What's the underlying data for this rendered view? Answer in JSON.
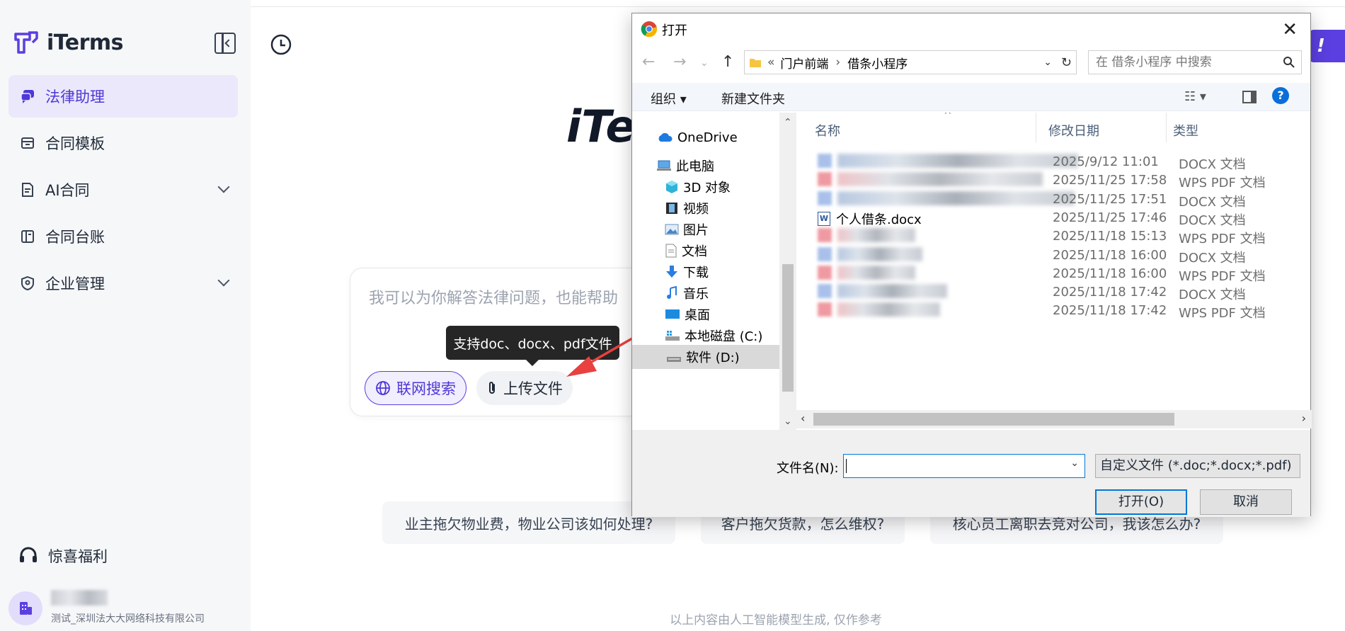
{
  "colors": {
    "accent": "#5b3fe0",
    "accent_soft": "#ebe8fb",
    "dialog_focus": "#0078d7",
    "arrow": "#e8413f"
  },
  "sidebar": {
    "logo_text": "iTerms",
    "items": [
      {
        "label": "法律助理",
        "icon": "chat-bubble-icon",
        "active": true
      },
      {
        "label": "合同模板",
        "icon": "archive-box-icon"
      },
      {
        "label": "AI合同",
        "icon": "document-icon",
        "expandable": true
      },
      {
        "label": "合同台账",
        "icon": "ledger-book-icon"
      },
      {
        "label": "企业管理",
        "icon": "shield-icon",
        "expandable": true
      }
    ],
    "bonus_label": "惊喜福利",
    "user_org": "测试_深圳法大大网络科技有限公司"
  },
  "main": {
    "title_fragment": "iTer",
    "top_right_fragment": "!",
    "chat_placeholder": "我可以为你解答法律问题，也能帮助",
    "web_search_label": "联网搜索",
    "upload_label": "上传文件",
    "tooltip": "支持doc、docx、pdf文件",
    "suggestions": [
      "业主拖欠物业费，物业公司该如何处理?",
      "客户拖欠货款，怎么维权?",
      "核心员工离职去竞对公司，我该怎么办?"
    ],
    "disclaimer": "以上内容由人工智能模型生成, 仅作参考"
  },
  "dialog": {
    "title": "打开",
    "path": [
      "门户前端",
      "借条小程序"
    ],
    "search_placeholder": "在 借条小程序 中搜索",
    "toolbar": {
      "organize": "组织 ▾",
      "new_folder": "新建文件夹"
    },
    "tree": [
      {
        "label": "OneDrive",
        "icon": "cloud-icon"
      },
      {
        "label": "此电脑",
        "icon": "computer-icon"
      },
      {
        "label": "3D 对象",
        "icon": "cube-icon"
      },
      {
        "label": "视频",
        "icon": "film-icon"
      },
      {
        "label": "图片",
        "icon": "picture-icon"
      },
      {
        "label": "文档",
        "icon": "document-icon"
      },
      {
        "label": "下载",
        "icon": "download-icon"
      },
      {
        "label": "音乐",
        "icon": "music-icon"
      },
      {
        "label": "桌面",
        "icon": "desktop-icon"
      },
      {
        "label": "本地磁盘 (C:)",
        "icon": "drive-icon"
      },
      {
        "label": "软件 (D:)",
        "icon": "drive-icon",
        "selected": true
      }
    ],
    "columns": {
      "name": "名称",
      "date": "修改日期",
      "type": "类型"
    },
    "files": [
      {
        "name": "",
        "date": "2025/9/12 11:01",
        "type": "DOCX 文档",
        "kind": "docx",
        "blur_w": 340
      },
      {
        "name": "",
        "date": "2025/11/25 17:58",
        "type": "WPS PDF 文档",
        "kind": "pdf",
        "blur_w": 290
      },
      {
        "name": "",
        "date": "2025/11/25 17:51",
        "type": "DOCX 文档",
        "kind": "docx",
        "blur_w": 335
      },
      {
        "name": "个人借条.docx",
        "date": "2025/11/25 17:46",
        "type": "DOCX 文档",
        "kind": "word"
      },
      {
        "name": "",
        "date": "2025/11/18 15:13",
        "type": "WPS PDF 文档",
        "kind": "pdf",
        "blur_w": 110
      },
      {
        "name": "",
        "date": "2025/11/18 16:00",
        "type": "DOCX 文档",
        "kind": "docx",
        "blur_w": 120
      },
      {
        "name": "",
        "date": "2025/11/18 16:00",
        "type": "WPS PDF 文档",
        "kind": "pdf",
        "blur_w": 110
      },
      {
        "name": "",
        "date": "2025/11/18 17:42",
        "type": "DOCX 文档",
        "kind": "docx",
        "blur_w": 155
      },
      {
        "name": "",
        "date": "2025/11/18 17:42",
        "type": "WPS PDF 文档",
        "kind": "pdf",
        "blur_w": 145
      }
    ],
    "filename_label": "文件名(N):",
    "filename_value": "",
    "filter": "自定义文件 (*.doc;*.docx;*.pdf)",
    "open_label": "打开(O)",
    "cancel_label": "取消"
  }
}
